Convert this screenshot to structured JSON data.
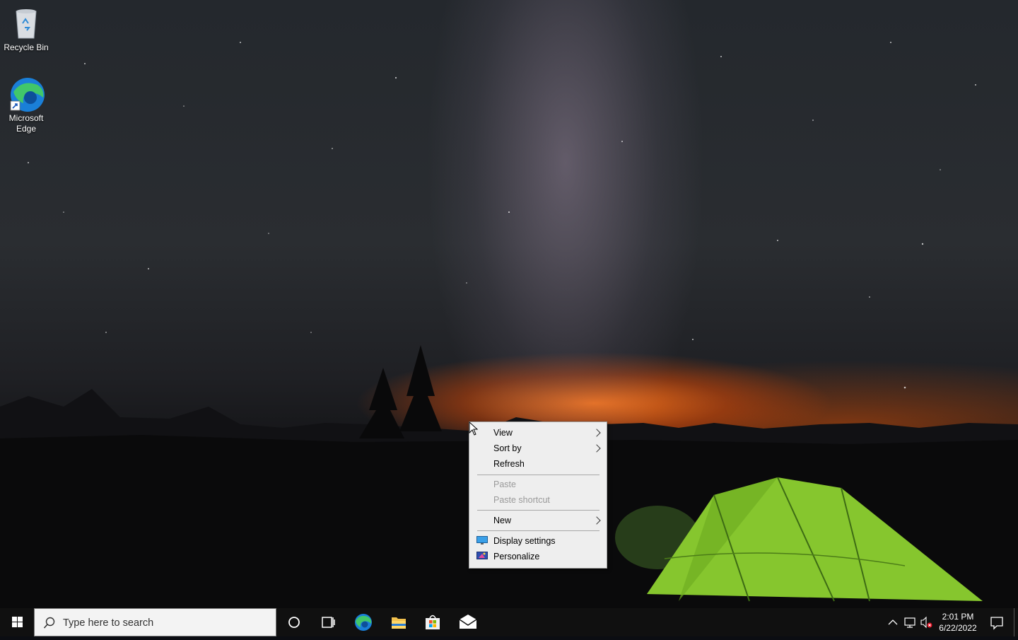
{
  "desktop": {
    "icons": [
      {
        "label": "Recycle Bin",
        "icon": "recycle-bin-icon"
      },
      {
        "label": "Microsoft Edge",
        "icon": "edge-icon"
      }
    ]
  },
  "context_menu": {
    "items": [
      {
        "label": "View",
        "submenu": true,
        "enabled": true
      },
      {
        "label": "Sort by",
        "submenu": true,
        "enabled": true
      },
      {
        "label": "Refresh",
        "submenu": false,
        "enabled": true
      },
      {
        "label": "Paste",
        "submenu": false,
        "enabled": false
      },
      {
        "label": "Paste shortcut",
        "submenu": false,
        "enabled": false
      },
      {
        "label": "New",
        "submenu": true,
        "enabled": true
      },
      {
        "label": "Display settings",
        "submenu": false,
        "enabled": true,
        "icon": "display-icon"
      },
      {
        "label": "Personalize",
        "submenu": false,
        "enabled": true,
        "icon": "personalize-icon"
      }
    ]
  },
  "taskbar": {
    "search_placeholder": "Type here to search",
    "pinned": [
      "cortana-icon",
      "task-view-icon",
      "edge-icon",
      "file-explorer-icon",
      "store-icon",
      "mail-icon"
    ],
    "tray": {
      "time": "2:01 PM",
      "date": "6/22/2022",
      "icons": [
        "chevron-up-icon",
        "network-icon",
        "volume-muted-icon",
        "notification-icon"
      ]
    }
  },
  "colors": {
    "taskbar": "#101010",
    "menu_bg": "#eeeeee",
    "edge_blue": "#1a7fd8",
    "edge_green": "#41c76a"
  }
}
